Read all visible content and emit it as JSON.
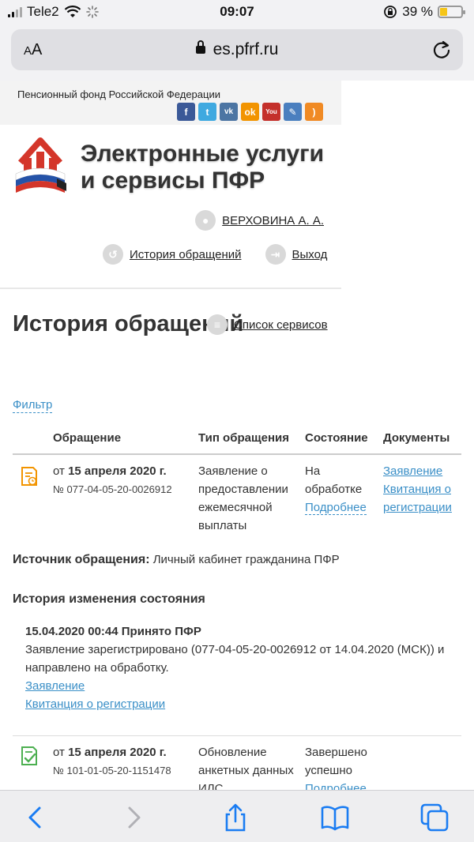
{
  "status": {
    "carrier": "Tele2",
    "time": "09:07",
    "battery": "39 %",
    "battery_level": 0.39
  },
  "browser": {
    "font_size_label_small": "A",
    "font_size_label_large": "A",
    "url": "es.pfrf.ru",
    "icons": [
      "lock-icon",
      "reload-icon",
      "back-icon",
      "forward-icon",
      "share-icon",
      "bookmarks-icon",
      "tabs-icon"
    ]
  },
  "header": {
    "org_name": "Пенсионный фонд Российской Федерации",
    "socials": [
      "facebook-icon",
      "twitter-icon",
      "vk-icon",
      "odnoklassniki-icon",
      "youtube-icon",
      "livejournal-icon",
      "rss-icon"
    ],
    "site_title": "Электронные услуги и сервисы ПФР",
    "user_name": "ВЕРХОВИНА А. А.",
    "nav_history": "История обращений",
    "nav_logout": "Выход"
  },
  "main": {
    "title": "История обращений",
    "services_link": "Список сервисов",
    "filter": "Фильтр",
    "columns": [
      "Обращение",
      "Тип обращения",
      "Состояние",
      "Документы"
    ],
    "rows": [
      {
        "date_prefix": "от ",
        "date": "15 апреля 2020 г.",
        "regno": "№ 077-04-05-20-0026912",
        "type": "Заявление о предоставлении ежемесячной выплаты",
        "status": "На обработке",
        "details": "Подробнее",
        "docs": [
          "Заявление",
          "Квитанция о регистрации"
        ]
      },
      {
        "date_prefix": "от ",
        "date": "15 апреля 2020 г.",
        "regno": "№ 101-01-05-20-1151478",
        "type": "Обновление анкетных данных ИЛС",
        "status": "Завершено успешно",
        "details": "Подробнее",
        "docs": []
      }
    ],
    "source_label": "Источник обращения:",
    "source_value": "Личный кабинет гражданина ПФР",
    "history_title": "История изменения состояния",
    "history": {
      "headline": "15.04.2020 00:44 Принято ПФР",
      "text": "Заявление зарегистрировано (077-04-05-20-0026912 от 14.04.2020 (МСК)) и направлено на обработку.",
      "links": [
        "Заявление",
        "Квитанция о регистрации"
      ]
    }
  },
  "colors": {
    "link": "#3a8fc7",
    "pfr_red": "#d4362a",
    "pfr_blue": "#2553a8",
    "ios_blue": "#1a7cf2"
  }
}
